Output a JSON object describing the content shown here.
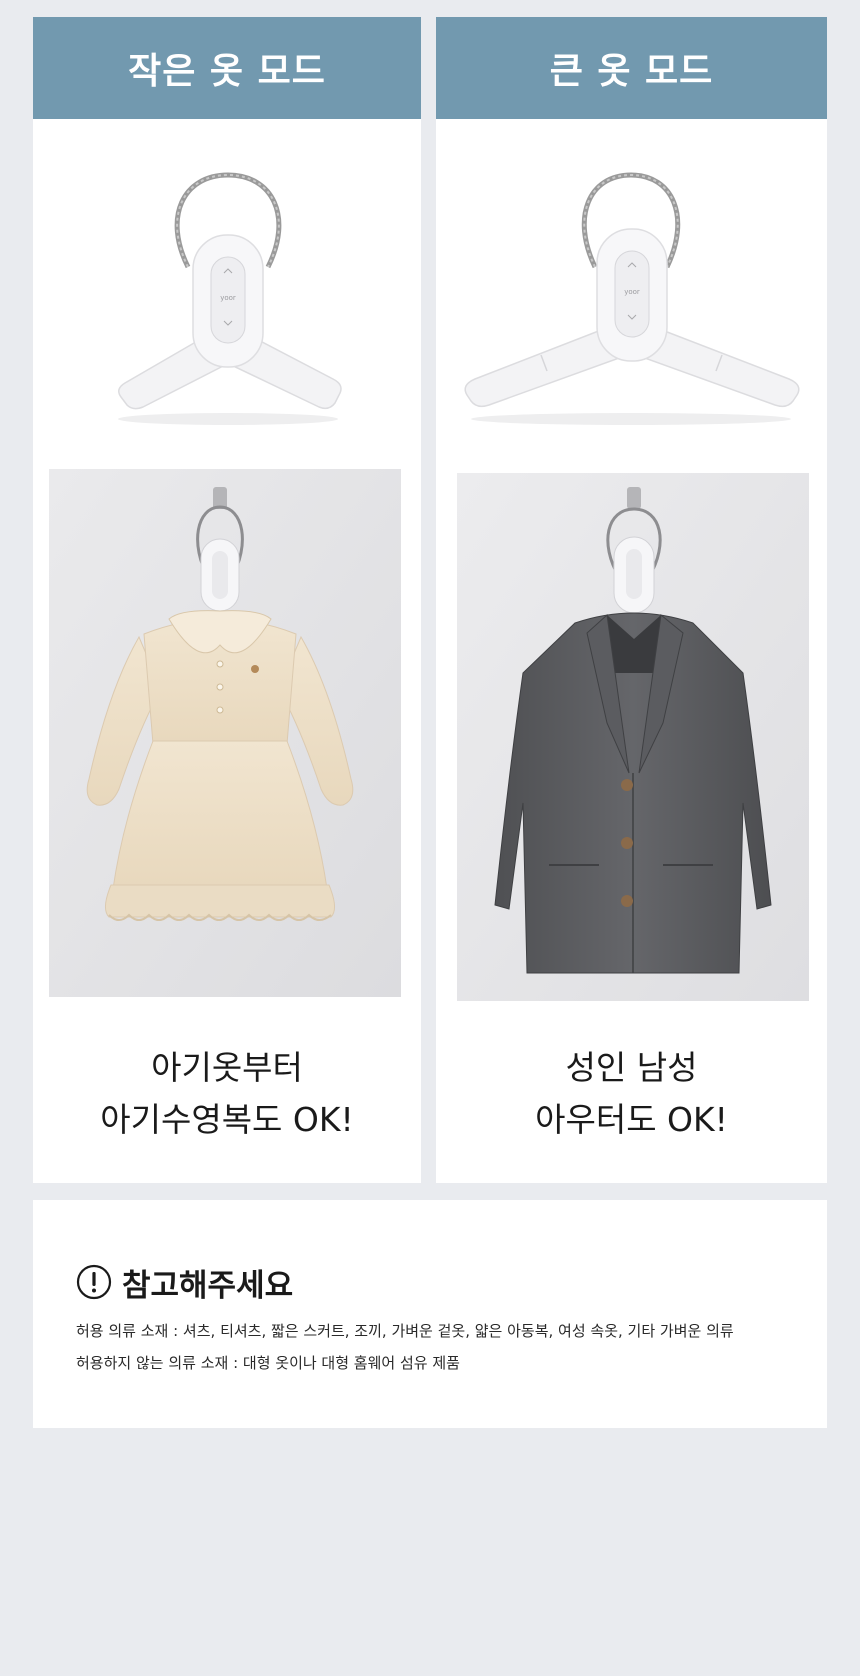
{
  "cards": [
    {
      "header": "작은 옷 모드",
      "hanger_mode": "folded-arms",
      "photo": "baby-dress",
      "caption_line1": "아기옷부터",
      "caption_line2": "아기수영복도 OK!"
    },
    {
      "header": "큰 옷 모드",
      "hanger_mode": "extended-arms",
      "photo": "men-coat",
      "caption_line1": "성인 남성",
      "caption_line2": "아우터도 OK!"
    }
  ],
  "notice": {
    "icon": "exclamation-circle-icon",
    "title": "참고해주세요",
    "allowed": "허용 의류 소재 : 셔츠, 티셔츠, 짧은 스커트, 조끼, 가벼운 겉옷, 얇은 아동복, 여성 속옷, 기타 가벼운 의류",
    "not_allowed": "허용하지 않는 의류 소재 :  대형 옷이나 대형 홈웨어 섬유 제품"
  },
  "colors": {
    "header_bg": "#7299af",
    "page_bg": "#e9ebef",
    "dress": "#efe2cc",
    "coat": "#5a5b5e"
  }
}
